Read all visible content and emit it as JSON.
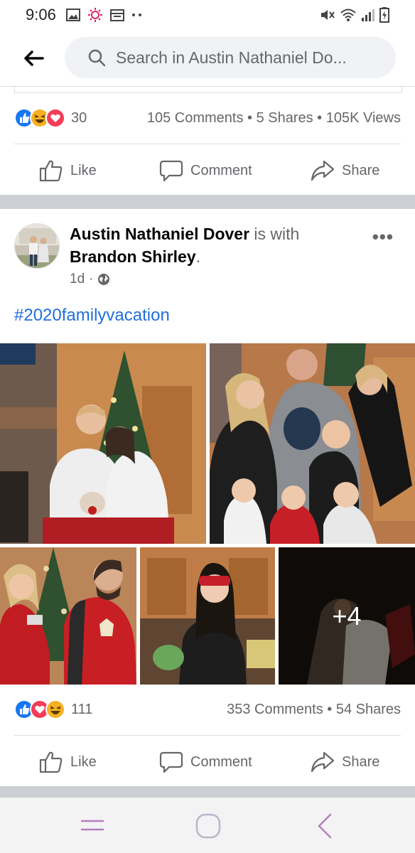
{
  "status_bar": {
    "time": "9:06"
  },
  "search": {
    "placeholder": "Search in Austin Nathaniel Do..."
  },
  "previous_post": {
    "reaction_count": "30",
    "stats": "105 Comments • 5 Shares • 105K Views"
  },
  "actions": {
    "like": "Like",
    "comment": "Comment",
    "share": "Share"
  },
  "post": {
    "author": "Austin Nathaniel Dover",
    "with_text": " is with ",
    "tagged": "Brandon Shirley",
    "period": ".",
    "time": "1d",
    "dot": "·",
    "hashtag": "#2020familyvacation",
    "more_photos": "+4",
    "reaction_count": "111",
    "stats": "353 Comments • 54 Shares"
  },
  "colors": {
    "like_blue": "#1877f2",
    "love_red": "#f33e58",
    "haha_yellow": "#f7b125",
    "link_blue": "#216fdb",
    "muted_gray": "#65676b"
  }
}
